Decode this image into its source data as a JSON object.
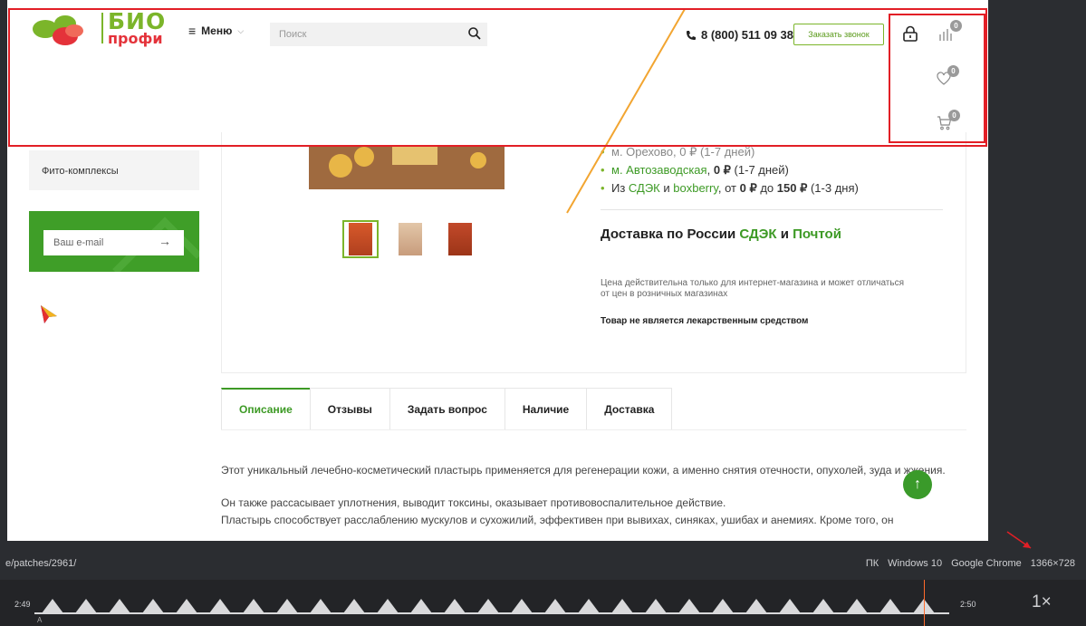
{
  "header": {
    "logo_top": "БИО",
    "logo_bottom": "профи",
    "menu_label": "Меню",
    "search_placeholder": "Поиск",
    "phone": "8 (800) 511 09 38",
    "call_button": "Заказать звонок",
    "compare_count": "0",
    "favorites_count": "0",
    "cart_count": "0"
  },
  "sidebar": {
    "category": "Фито-комплексы",
    "email_placeholder": "Ваш e-mail"
  },
  "delivery": {
    "items": [
      {
        "partial": "м. Орехово, 0 ₽ (1-7 дней)"
      },
      {
        "link": "м. Автозаводская",
        "sep": ", ",
        "price": "0 ₽",
        "days": " (1-7 дней)"
      },
      {
        "prefix": "Из ",
        "link1": "СДЭК",
        "mid": " и ",
        "link2": "boxberry",
        "from": ", от ",
        "p1": "0 ₽",
        "to": " до ",
        "p2": "150 ₽",
        "days": " (1-3 дня)"
      }
    ],
    "russia_prefix": "Доставка по России ",
    "russia_link1": "СДЭК",
    "russia_mid": " и ",
    "russia_link2": "Почтой",
    "price_note": "Цена действительна только для интернет-магазина и может отличаться от цен в розничных магазинах",
    "not_medicine": "Товар не является лекарственным средством"
  },
  "tabs": [
    "Описание",
    "Отзывы",
    "Задать вопрос",
    "Наличие",
    "Доставка"
  ],
  "description": [
    "Этот уникальный лечебно-косметический пластырь применяется для регенерации кожи, а именно снятия отечности, опухолей, зуда и жжения.",
    "Он также рассасывает уплотнения, выводит токсины, оказывает противовоспалительное действие.",
    "Пластырь способствует расслаблению мускулов и сухожилий, эффективен при вывихах, синяках, ушибах и анемиях. Кроме того, он"
  ],
  "player": {
    "url": "e/patches/2961/",
    "platform": "ПК",
    "os": "Windows 10",
    "browser": "Google Chrome",
    "resolution": "1366×728",
    "time_start": "2:49",
    "time_end": "2:50",
    "speed": "1×",
    "track_label": "A"
  },
  "colors": {
    "accent": "#3d9a25",
    "annotation": "#e21f26",
    "playhead": "#ff6a2a"
  }
}
